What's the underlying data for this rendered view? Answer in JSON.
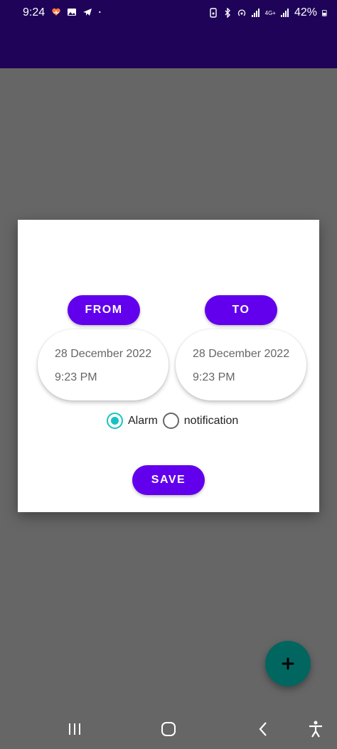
{
  "status_bar": {
    "time": "9:24",
    "battery": "42%",
    "network": "4G+",
    "left_icons": [
      "health-icon",
      "gallery-icon",
      "telegram-icon",
      "dot-icon"
    ],
    "right_icons": [
      "sim-icon",
      "bluetooth-icon",
      "hotspot-icon",
      "signal-icon",
      "network-4g-icon",
      "signal-icon",
      "battery-icon"
    ]
  },
  "dialog": {
    "from_button": "FROM",
    "to_button": "TO",
    "from": {
      "date": "28 December 2022",
      "time": "9:23 PM"
    },
    "to": {
      "date": "28 December 2022",
      "time": "9:23 PM"
    },
    "radio_options": [
      {
        "label": "Alarm",
        "checked": true
      },
      {
        "label": "notification",
        "checked": false
      }
    ],
    "save_button": "SAVE"
  },
  "fab": {
    "icon": "plus-icon"
  },
  "nav_bar": {
    "icons": [
      "recent-apps-icon",
      "home-icon",
      "back-icon",
      "accessibility-icon"
    ]
  },
  "colors": {
    "app_bar": "#1e0358",
    "primary_button": "#6200ee",
    "radio_accent": "#19c2c2",
    "fab": "#016660",
    "scrim": "#666666"
  }
}
